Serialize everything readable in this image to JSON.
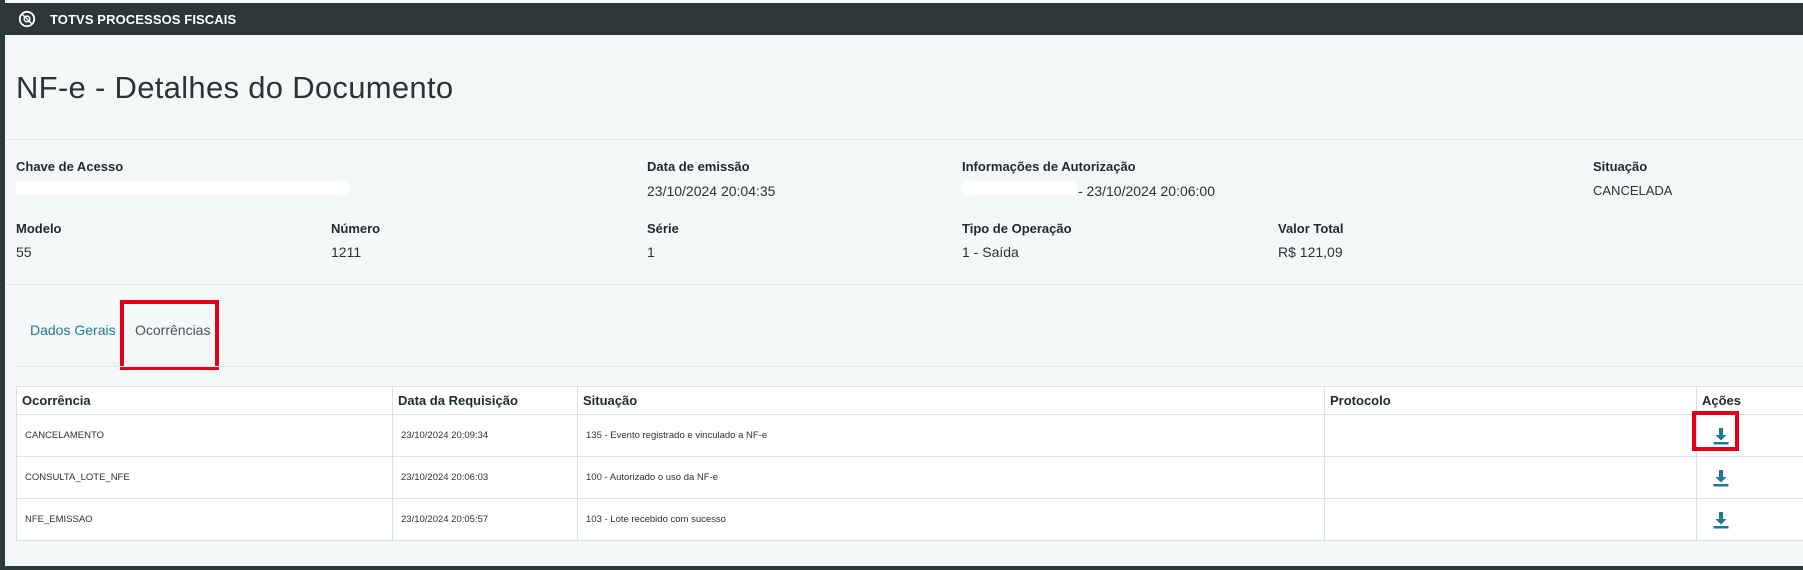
{
  "app": {
    "title": "TOTVS PROCESSOS FISCAIS",
    "logo_icon": "totvs-logo-icon"
  },
  "page": {
    "title": "NF-e - Detalhes do Documento"
  },
  "details": {
    "chave_label": "Chave de Acesso",
    "data_emissao_label": "Data de emissão",
    "data_emissao_value": "23/10/2024 20:04:35",
    "info_autorizacao_label": "Informações de Autorização",
    "info_autorizacao_value": "- 23/10/2024 20:06:00",
    "situacao_label": "Situação",
    "situacao_value": "CANCELADA",
    "modelo_label": "Modelo",
    "modelo_value": "55",
    "numero_label": "Número",
    "numero_value": "1211",
    "serie_label": "Série",
    "serie_value": "1",
    "tipo_operacao_label": "Tipo de Operação",
    "tipo_operacao_value": "1 - Saída",
    "valor_total_label": "Valor Total",
    "valor_total_value": "R$ 121,09"
  },
  "tabs": [
    {
      "label": "Dados Gerais",
      "active": false
    },
    {
      "label": "Ocorrências",
      "active": true
    }
  ],
  "table": {
    "headers": [
      "Ocorrência",
      "Data da Requisição",
      "Situação",
      "Protocolo",
      "Ações"
    ],
    "rows": [
      {
        "ocorrencia": "CANCELAMENTO",
        "data": "23/10/2024 20:09:34",
        "situacao": "135 - Evento registrado e vinculado a NF-e",
        "protocolo": "",
        "acao_icon": "download-icon"
      },
      {
        "ocorrencia": "CONSULTA_LOTE_NFE",
        "data": "23/10/2024 20:06:03",
        "situacao": "100 - Autorizado o uso da NF-e",
        "protocolo": "",
        "acao_icon": "download-icon"
      },
      {
        "ocorrencia": "NFE_EMISSAO",
        "data": "23/10/2024 20:05:57",
        "situacao": "103 - Lote recebido com sucesso",
        "protocolo": "",
        "acao_icon": "download-icon"
      }
    ]
  },
  "colors": {
    "topbar": "#2d3739",
    "accent": "#1f7b95",
    "highlight": "#e2001a",
    "background": "#f4f8f8"
  }
}
